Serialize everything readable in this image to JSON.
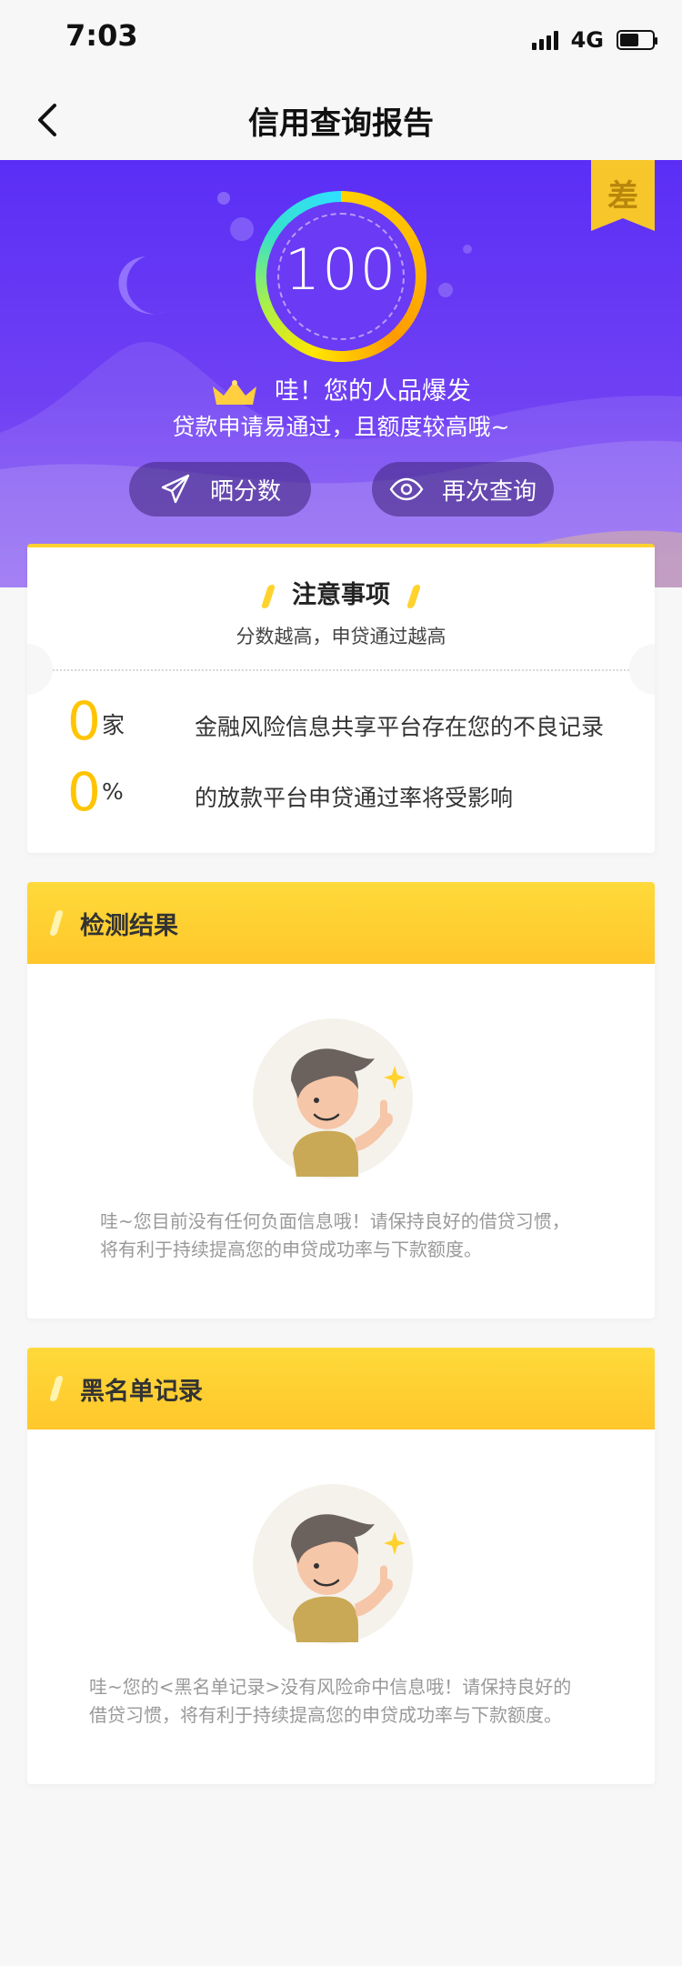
{
  "status_bar": {
    "time": "7:03",
    "network": "4G"
  },
  "nav": {
    "title": "信用查询报告"
  },
  "hero": {
    "badge": "差",
    "score": "100",
    "headline": "哇！您的人品爆发",
    "subline": "贷款申请易通过，且额度较高哦~",
    "share_button": "晒分数",
    "requery_button": "再次查询"
  },
  "notice": {
    "title": "注意事项",
    "subtitle": "分数越高，申贷通过越高",
    "stats": [
      {
        "value": "0",
        "unit": "家",
        "text": "金融风险信息共享平台存在您的不良记录"
      },
      {
        "value": "0",
        "unit": "%",
        "text": "的放款平台申贷通过率将受影响"
      }
    ]
  },
  "detection": {
    "title": "检测结果",
    "desc_line1": "哇~您目前没有任何负面信息哦！请保持良好的借贷习惯，",
    "desc_line2": "将有利于持续提高您的申贷成功率与下款额度。"
  },
  "blacklist": {
    "title": "黑名单记录",
    "desc_line1": "哇~您的<黑名单记录>没有风险命中信息哦！请保持良好的",
    "desc_line2": "借贷习惯，将有利于持续提高您的申贷成功率与下款额度。"
  },
  "colors": {
    "hero_purple": "#5b2ef6",
    "accent_yellow": "#ffc400",
    "section_yellow": "#ffd22e"
  },
  "icons": [
    "back-icon",
    "signal-icon",
    "battery-icon",
    "crown-icon",
    "paper-plane-icon",
    "eye-icon",
    "moon-icon"
  ]
}
